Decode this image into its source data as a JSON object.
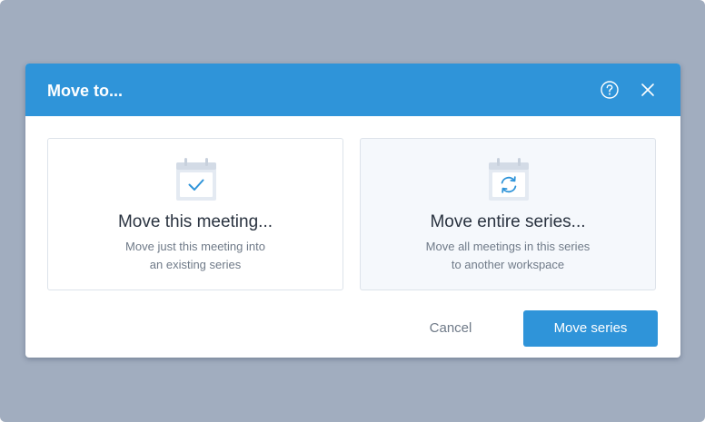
{
  "dialog": {
    "title": "Move to...",
    "help_icon": "question-circle-icon",
    "close_icon": "close-icon"
  },
  "options": [
    {
      "icon": "calendar-check-icon",
      "title": "Move this meeting...",
      "description_line1": "Move just this meeting into",
      "description_line2": "an existing series",
      "selected": false
    },
    {
      "icon": "calendar-refresh-icon",
      "title": "Move entire series...",
      "description_line1": "Move all meetings in this series",
      "description_line2": "to another workspace",
      "selected": true
    }
  ],
  "footer": {
    "cancel_label": "Cancel",
    "primary_label": "Move series"
  },
  "colors": {
    "backdrop": "#a1adbf",
    "header": "#2f94d9",
    "primary_button": "#2f94d9",
    "selected_card_bg": "#f5f8fc",
    "icon_fill": "#e4eaf2",
    "icon_accent": "#2f94d9"
  }
}
